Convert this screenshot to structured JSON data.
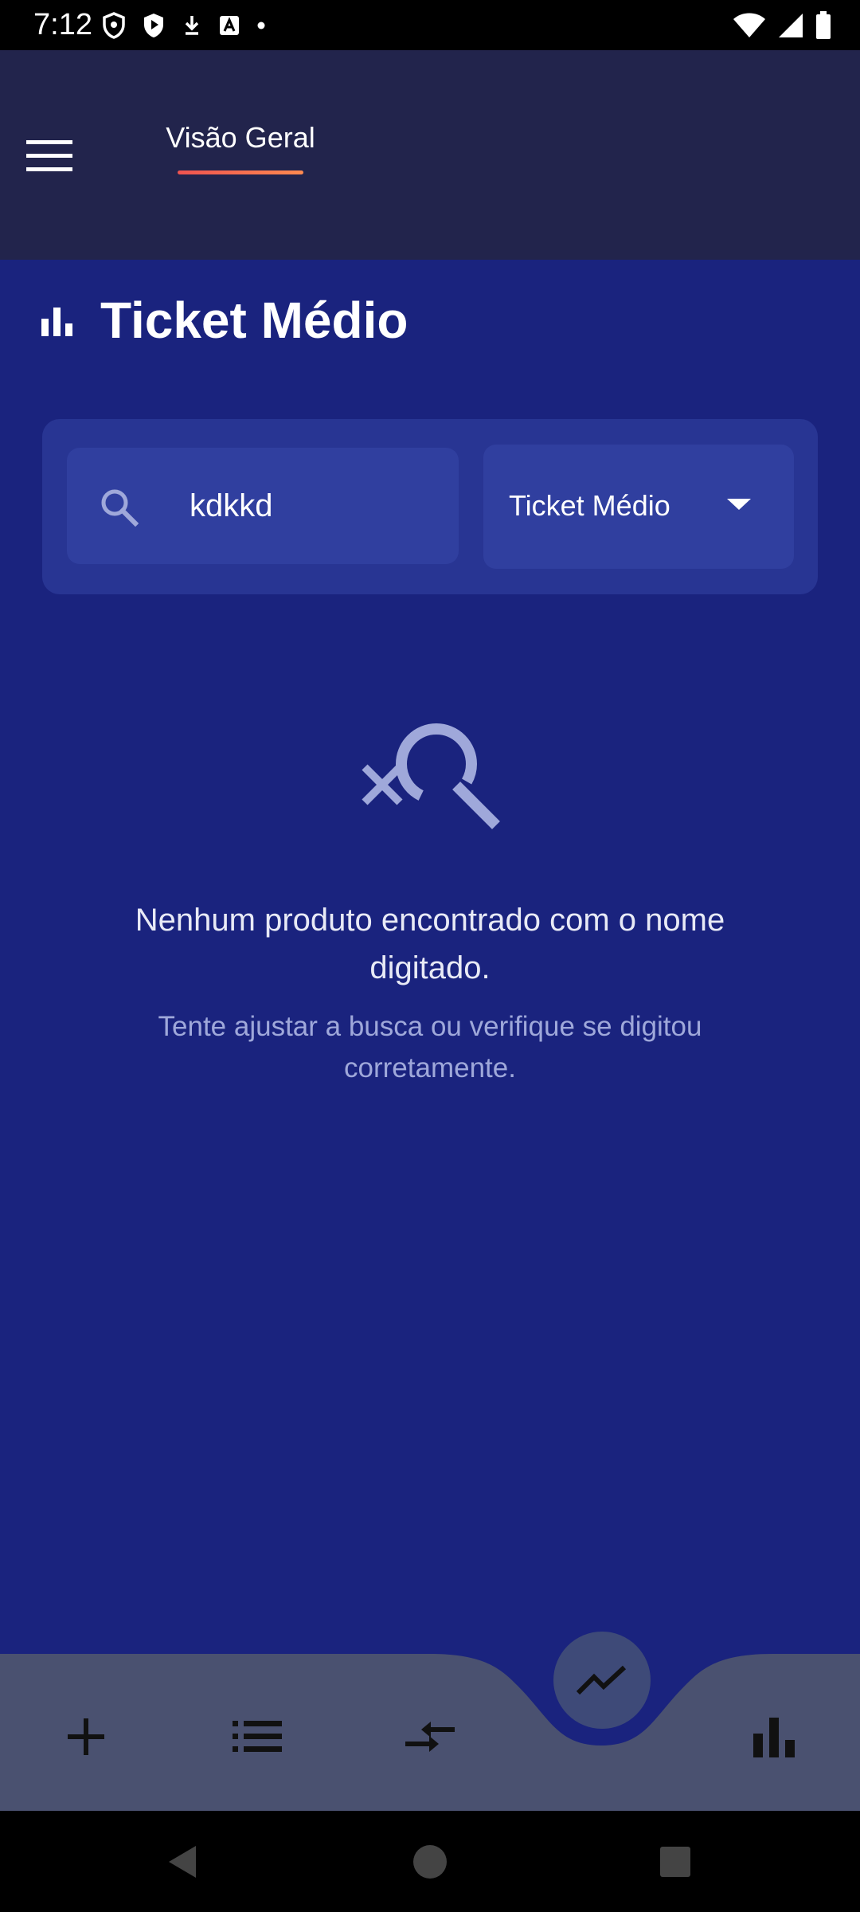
{
  "status_bar": {
    "time": "7:12"
  },
  "app_bar": {
    "tab_overview": "Visão Geral"
  },
  "page": {
    "title": "Ticket Médio"
  },
  "filters": {
    "search_value": "kdkkd",
    "metric_selected": "Ticket Médio"
  },
  "empty_state": {
    "title": "Nenhum produto encontrado com o nome digitado.",
    "subtitle": "Tente ajustar a busca ou verifique se digitou corretamente."
  },
  "bottom_nav": {
    "items": [
      {
        "icon": "add-icon"
      },
      {
        "icon": "list-icon"
      },
      {
        "icon": "compare-arrows-icon"
      },
      {
        "icon": "trending-icon",
        "active": true
      },
      {
        "icon": "bar-chart-icon"
      }
    ]
  },
  "colors": {
    "background": "#1a237e",
    "app_bar": "#22244c",
    "card": "#283593",
    "field": "#303f9f",
    "bottom_nav": "#4a5170",
    "tab_indicator_start": "#ef5350",
    "tab_indicator_end": "#ff8a50"
  }
}
